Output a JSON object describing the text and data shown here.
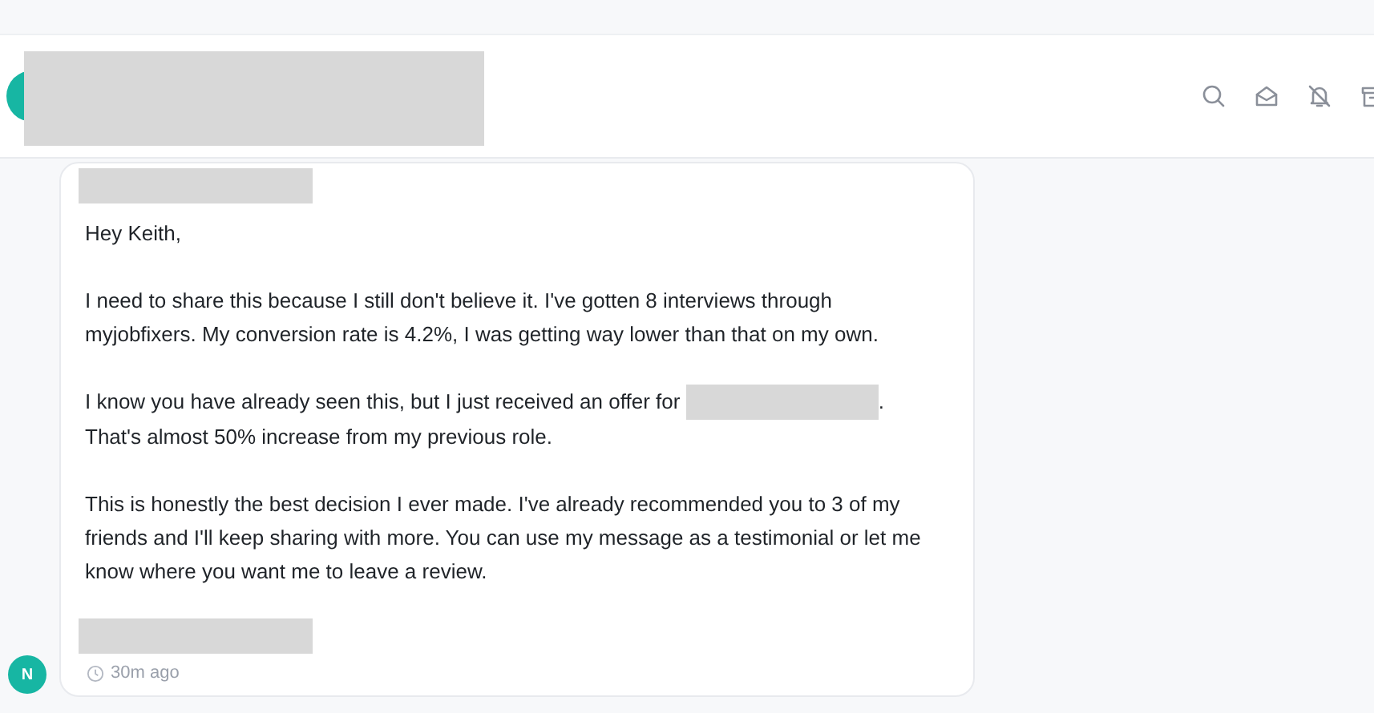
{
  "header": {
    "avatar_redacted": true,
    "actions": [
      {
        "kind": "search"
      },
      {
        "kind": "read"
      },
      {
        "kind": "mute"
      },
      {
        "kind": "archive"
      }
    ]
  },
  "message": {
    "sender_redacted": true,
    "paragraphs": [
      {
        "segments": [
          {
            "kind": "text",
            "text": "Hey Keith,"
          }
        ]
      },
      {
        "segments": [
          {
            "kind": "text",
            "text": "I need to share this because I still don't believe it. I've gotten 8 interviews through myjobfixers. My conversion rate is 4.2%, I was getting way lower than that on my own."
          }
        ]
      },
      {
        "segments": [
          {
            "kind": "text",
            "text": "I know you have already seen this, but I just received an offer for "
          },
          {
            "kind": "redacted"
          },
          {
            "kind": "text",
            "text": ". That's almost 50% increase from my previous role."
          }
        ]
      },
      {
        "segments": [
          {
            "kind": "text",
            "text": "This is honestly the best decision I ever made. I've already recommended you to 3 of my friends and I'll keep sharing with more. You can use my message as a testimonial or let me know where you want me to leave a review."
          }
        ]
      }
    ],
    "signature_redacted": true,
    "time": "30m ago",
    "avatar": "N"
  }
}
